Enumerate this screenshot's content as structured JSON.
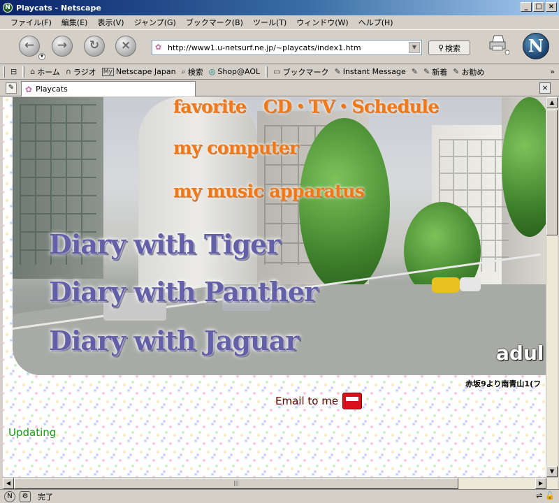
{
  "window": {
    "title": "Playcats - Netscape",
    "minimize": "_",
    "maximize": "□",
    "close": "×"
  },
  "menu": [
    "ファイル(F)",
    "編集(E)",
    "表示(V)",
    "ジャンプ(G)",
    "ブックマーク(B)",
    "ツール(T)",
    "ウィンドウ(W)",
    "ヘルプ(H)"
  ],
  "nav": {
    "url": "http://www1.u-netsurf.ne.jp/~playcats/index1.htm",
    "search_label": "検索"
  },
  "personal_toolbar": {
    "items": [
      {
        "icon": "⌂",
        "label": "ホーム"
      },
      {
        "icon": "∩",
        "label": "ラジオ"
      },
      {
        "icon": "My",
        "label": "Netscape Japan"
      },
      {
        "icon": "⌕",
        "label": "検索"
      },
      {
        "icon": "◎",
        "label": "Shop@AOL"
      },
      {
        "icon": "▭",
        "label": "ブックマーク"
      },
      {
        "icon": "✎",
        "label": "Instant Message"
      },
      {
        "icon": "✎",
        "label": ""
      },
      {
        "icon": "✎",
        "label": "新着"
      },
      {
        "icon": "✎",
        "label": "お勧め"
      }
    ],
    "more": "»"
  },
  "tabs": [
    {
      "label": "Playcats"
    }
  ],
  "page": {
    "menu_links": [
      {
        "text": "favorite　CD・TV・Schedule"
      },
      {
        "text": "my computer"
      },
      {
        "text": "my music apparatus"
      }
    ],
    "diary_links": [
      {
        "text": "Diary with Tiger"
      },
      {
        "text": "Diary with Panther"
      },
      {
        "text": "Diary with Jaguar"
      }
    ],
    "adult_label": "adul",
    "route_text": "赤坂9より南青山1(フ",
    "email_link": "Email to me",
    "updating": "Updating"
  },
  "status": {
    "text": "完了"
  }
}
